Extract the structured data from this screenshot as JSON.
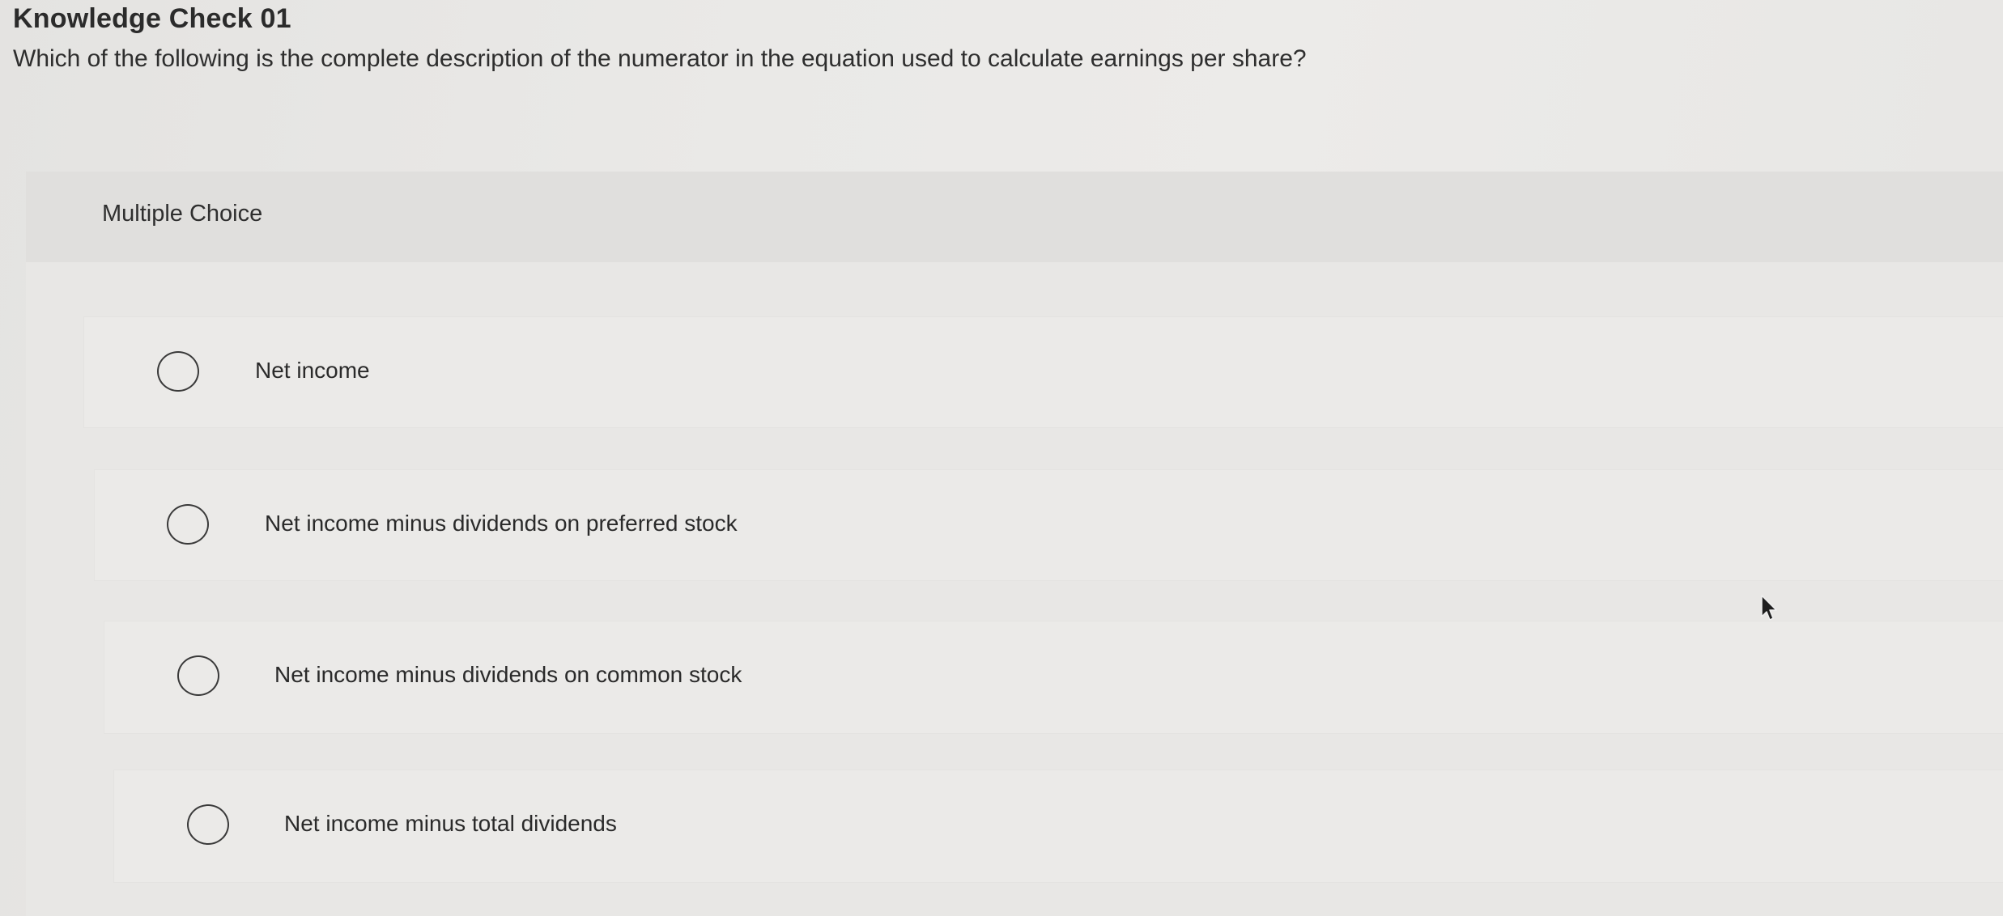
{
  "header": {
    "title": "Knowledge Check 01",
    "question": "Which of the following is the complete description of the numerator in the equation used to calculate earnings per share?"
  },
  "panel": {
    "label": "Multiple Choice",
    "choices": [
      {
        "label": "Net income",
        "selected": false
      },
      {
        "label": "Net income minus dividends on preferred stock",
        "selected": false
      },
      {
        "label": "Net income minus dividends on common stock",
        "selected": false
      },
      {
        "label": "Net income minus total dividends",
        "selected": false
      }
    ]
  },
  "icons": {
    "radio": "radio-unselected-icon",
    "cursor": "mouse-pointer-icon"
  }
}
